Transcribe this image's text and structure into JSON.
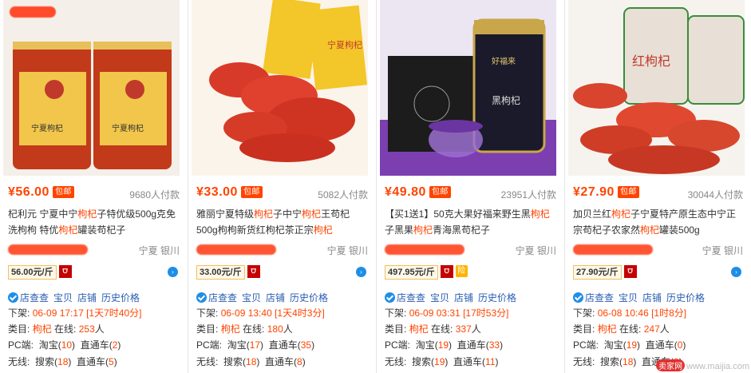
{
  "cards": [
    {
      "price": "¥56.00",
      "baoyou": "包邮",
      "paid": "9680人付款",
      "title_parts": [
        "杞利元 宁夏中宁",
        "枸杞",
        "子特优级500g克免洗枸枸 特优",
        "枸杞",
        "罐装苟杞子"
      ],
      "location": "宁夏 银川",
      "unit_price": "56.00元/斤",
      "has_insure": false,
      "links": [
        "店查查",
        "宝贝",
        "店铺",
        "历史价格"
      ],
      "xiajia_label": "下架:",
      "xiajia_time": "06-09 17:17",
      "xiajia_left": "[1天7时40分]",
      "category_label": "类目:",
      "category": "枸杞",
      "online_label": "在线:",
      "online": "253",
      "online_unit": "人",
      "pc_label": "PC端:",
      "pc_taobao": "淘宝(",
      "pc_taobao_n": "10",
      "pc_ztc": "直通车(",
      "pc_ztc_n": "2",
      "wx_label": "无线:",
      "wx_search": "搜索(",
      "wx_search_n": "18",
      "wx_ztc": "直通车(",
      "wx_ztc_n": "5"
    },
    {
      "price": "¥33.00",
      "baoyou": "包邮",
      "paid": "5082人付款",
      "title_parts": [
        "雅丽宁夏特级",
        "枸杞",
        "子中宁",
        "枸杞",
        "王苟杞500g枸枸新货红枸杞茶正宗",
        "枸杞",
        ""
      ],
      "location": "宁夏 银川",
      "unit_price": "33.00元/斤",
      "has_insure": false,
      "links": [
        "店查查",
        "宝贝",
        "店铺",
        "历史价格"
      ],
      "xiajia_label": "下架:",
      "xiajia_time": "06-09 13:40",
      "xiajia_left": "[1天4时3分]",
      "category_label": "类目:",
      "category": "枸杞",
      "online_label": "在线:",
      "online": "180",
      "online_unit": "人",
      "pc_label": "PC端:",
      "pc_taobao": "淘宝(",
      "pc_taobao_n": "17",
      "pc_ztc": "直通车(",
      "pc_ztc_n": "35",
      "wx_label": "无线:",
      "wx_search": "搜索(",
      "wx_search_n": "18",
      "wx_ztc": "直通车(",
      "wx_ztc_n": "8"
    },
    {
      "price": "¥49.80",
      "baoyou": "包邮",
      "paid": "23951人付款",
      "title_parts": [
        "【买1送1】50克大果好福来野生黑",
        "枸杞",
        "子黑果",
        "枸杞",
        "青海黑苟杞子"
      ],
      "location": "宁夏 银川",
      "unit_price": "497.95元/斤",
      "has_insure": true,
      "insure_label": "险",
      "links": [
        "店查查",
        "宝贝",
        "店铺",
        "历史价格"
      ],
      "xiajia_label": "下架:",
      "xiajia_time": "06-09 03:31",
      "xiajia_left": "[17时53分]",
      "category_label": "类目:",
      "category": "枸杞",
      "online_label": "在线:",
      "online": "337",
      "online_unit": "人",
      "pc_label": "PC端:",
      "pc_taobao": "淘宝(",
      "pc_taobao_n": "19",
      "pc_ztc": "直通车(",
      "pc_ztc_n": "33",
      "wx_label": "无线:",
      "wx_search": "搜索(",
      "wx_search_n": "19",
      "wx_ztc": "直通车(",
      "wx_ztc_n": "11"
    },
    {
      "price": "¥27.90",
      "baoyou": "包邮",
      "paid": "30044人付款",
      "title_parts": [
        "加贝兰红",
        "枸杞",
        "子宁夏特产原生态中宁正宗苟杞子农家然",
        "枸杞",
        "罐装500g"
      ],
      "location": "宁夏 银川",
      "unit_price": "27.90元/斤",
      "has_insure": false,
      "links": [
        "店查查",
        "宝贝",
        "店铺",
        "历史价格"
      ],
      "xiajia_label": "下架:",
      "xiajia_time": "06-08 10:46",
      "xiajia_left": "[1时8分]",
      "category_label": "类目:",
      "category": "枸杞",
      "online_label": "在线:",
      "online": "247",
      "online_unit": "人",
      "pc_label": "PC端:",
      "pc_taobao": "淘宝(",
      "pc_taobao_n": "19",
      "pc_ztc": "直通车(",
      "pc_ztc_n": "0",
      "wx_label": "无线:",
      "wx_search": "搜索(",
      "wx_search_n": "18",
      "wx_ztc": "直通车(",
      "wx_ztc_n": "0"
    }
  ],
  "image_texts": {
    "jar_label": "宁夏枸杞",
    "bag_label": "宁夏枸杞",
    "can_label": "好福来",
    "box_label": "黑枸杞",
    "red_label": "红枸杞"
  },
  "watermark": {
    "badge": "卖家网",
    "text": "www.maijia.com"
  },
  "colors": {
    "accent": "#ff4400",
    "link": "#2a5db0"
  }
}
